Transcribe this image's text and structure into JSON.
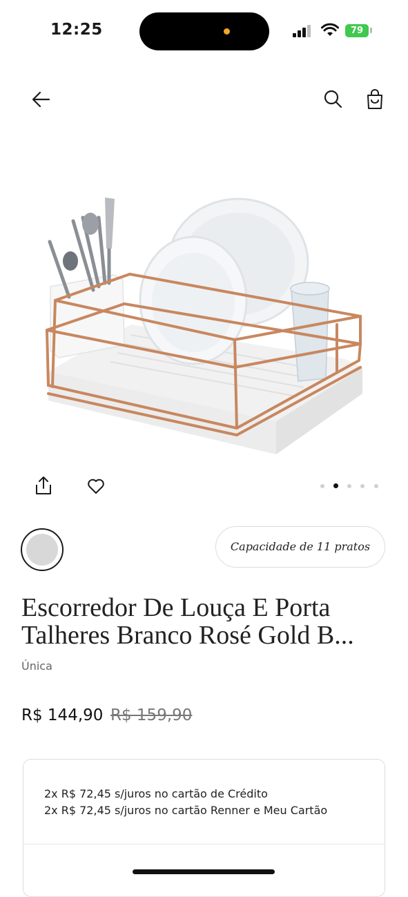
{
  "status_bar": {
    "time": "12:25",
    "battery": "79"
  },
  "header": {
    "back_icon": "arrow-left-icon",
    "search_icon": "search-icon",
    "bag_icon": "shopping-bag-icon"
  },
  "gallery": {
    "image_subject": "dish rack with rose gold wire frame, plates, cutlery holder and glass",
    "dots_count": 5,
    "active_dot": 2
  },
  "actions": {
    "share_icon": "share-icon",
    "favorite_icon": "heart-icon"
  },
  "variant": {
    "swatch_color": "#d8d8d8",
    "chip_label": "Capacidade de 11 pratos"
  },
  "product": {
    "title_line1": "Escorredor De Louça E Porta",
    "title_line2": "Talheres Branco Rosé Gold B...",
    "size": "Única",
    "price": "R$ 144,90",
    "old_price": "R$ 159,90"
  },
  "installments": {
    "line1": "2x R$ 72,45 s/juros no cartão de Crédito",
    "line2": "2x R$ 72,45 s/juros no cartão Renner e Meu Cartão"
  },
  "colors": {
    "rose_gold": "#c8875f",
    "text": "#1a1a1a"
  }
}
